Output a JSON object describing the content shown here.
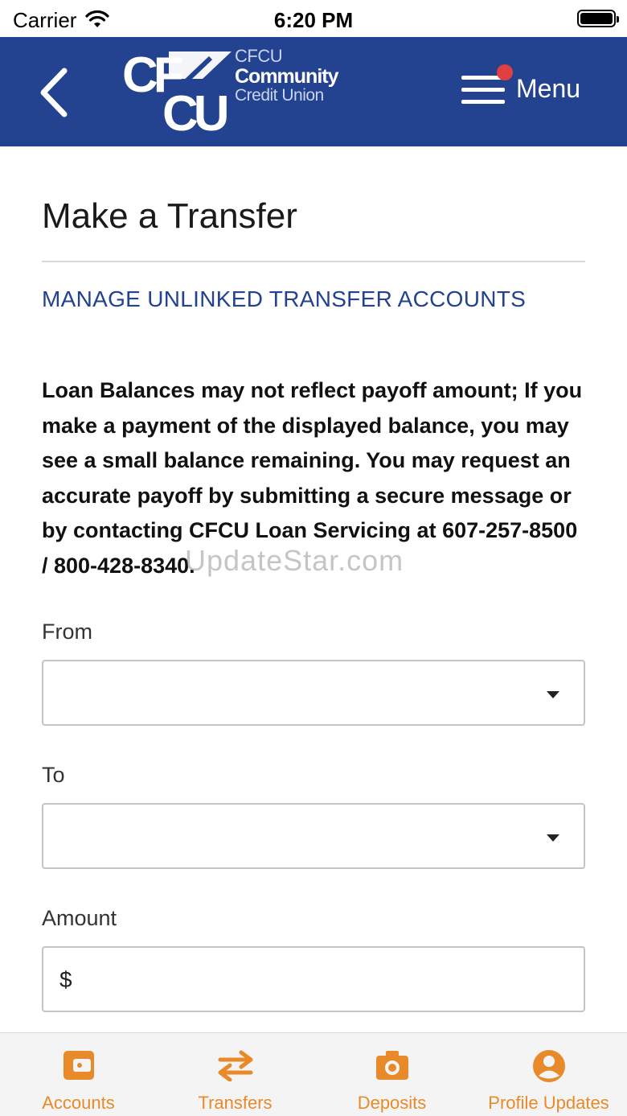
{
  "status_bar": {
    "carrier": "Carrier",
    "time": "6:20 PM"
  },
  "header": {
    "logo_mark": "CFCU",
    "logo_line1": "CFCU",
    "logo_line2": "Community",
    "logo_line3": "Credit Union",
    "menu_label": "Menu",
    "brand_color": "#23428f",
    "notification_dot_color": "#e04040"
  },
  "main": {
    "title": "Make a Transfer",
    "manage_link": "MANAGE UNLINKED TRANSFER ACCOUNTS",
    "notice": "Loan Balances may not reflect payoff amount; If you make a payment of the displayed balance, you may see a small balance remaining. You may request an accurate payoff by submitting a secure message or by contacting CFCU Loan Servicing at 607-257-8500 / 800-428-8340.",
    "watermark": "UpdateStar.com",
    "from": {
      "label": "From",
      "value": ""
    },
    "to": {
      "label": "To",
      "value": ""
    },
    "amount": {
      "label": "Amount",
      "prefix": "$",
      "value": ""
    }
  },
  "tab_bar": {
    "accent_color": "#e88a2a",
    "tabs": [
      {
        "label": "Accounts",
        "icon": "wallet-icon"
      },
      {
        "label": "Transfers",
        "icon": "transfer-arrows-icon"
      },
      {
        "label": "Deposits",
        "icon": "camera-icon"
      },
      {
        "label": "Profile Updates",
        "icon": "profile-icon"
      }
    ]
  }
}
